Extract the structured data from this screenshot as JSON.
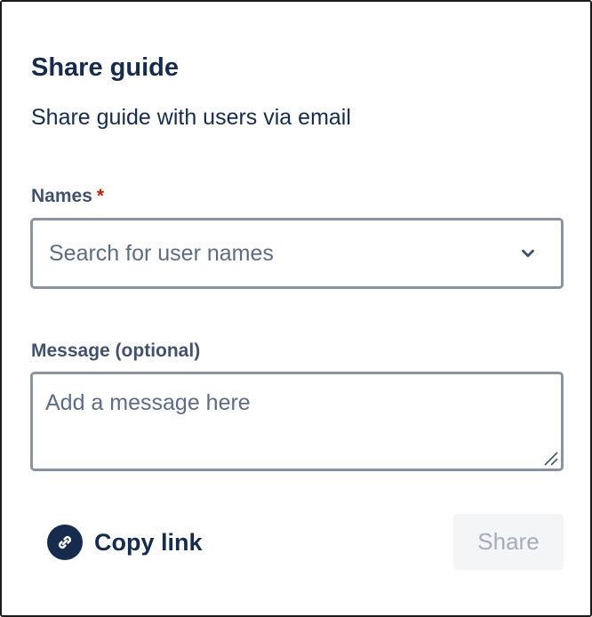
{
  "dialog": {
    "title": "Share guide",
    "subtitle": "Share guide with users via email"
  },
  "names_field": {
    "label": "Names",
    "required_marker": "*",
    "placeholder": "Search for user names",
    "icon": "chevron-down-icon"
  },
  "message_field": {
    "label": "Message (optional)",
    "placeholder": "Add a message here"
  },
  "footer": {
    "copy_link_label": "Copy link",
    "copy_link_icon": "link-icon",
    "share_label": "Share"
  },
  "colors": {
    "text_primary": "#172b4d",
    "label": "#42526e",
    "required": "#bf2600",
    "field_border": "#8993a4",
    "disabled_bg": "#f4f5f7",
    "disabled_text": "#a5adba"
  }
}
